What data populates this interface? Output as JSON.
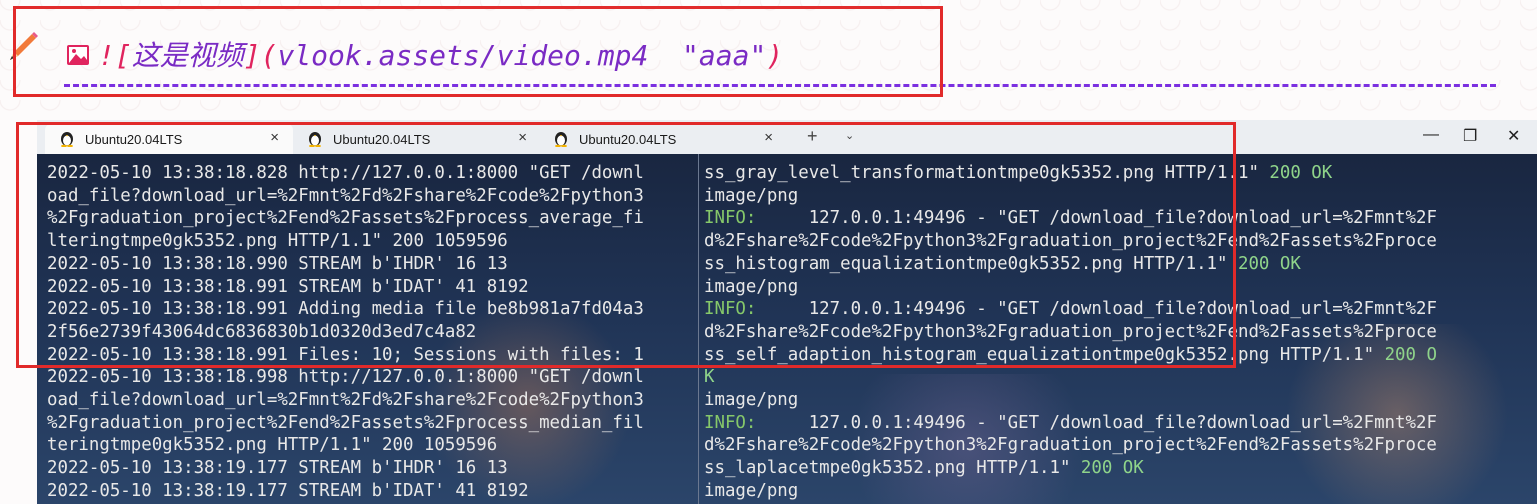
{
  "markdown": {
    "bang_bracket": "![",
    "alt_text": "这是视频",
    "close_bracket": "]",
    "open_paren": "(",
    "link": "vlook.assets/video.mp4  \"aaa\"",
    "close_paren": ")"
  },
  "terminal": {
    "tabs": [
      {
        "label": "Ubuntu20.04LTS",
        "close": "×"
      },
      {
        "label": "Ubuntu20.04LTS",
        "close": "×"
      },
      {
        "label": "Ubuntu20.04LTS",
        "close": "×"
      }
    ],
    "new_tab": "+",
    "dropdown": "⌄",
    "minimize": "—",
    "maximize": "❐",
    "close": "✕",
    "left_lines": [
      "2022-05-10 13:38:18.828 http://127.0.0.1:8000 \"GET /downl",
      "oad_file?download_url=%2Fmnt%2Fd%2Fshare%2Fcode%2Fpython3",
      "%2Fgraduation_project%2Fend%2Fassets%2Fprocess_average_fi",
      "lteringtmpe0gk5352.png HTTP/1.1\" 200 1059596",
      "2022-05-10 13:38:18.990 STREAM b'IHDR' 16 13",
      "2022-05-10 13:38:18.991 STREAM b'IDAT' 41 8192",
      "2022-05-10 13:38:18.991 Adding media file be8b981a7fd04a3",
      "2f56e2739f43064dc6836830b1d0320d3ed7c4a82",
      "2022-05-10 13:38:18.991 Files: 10; Sessions with files: 1",
      "2022-05-10 13:38:18.998 http://127.0.0.1:8000 \"GET /downl",
      "oad_file?download_url=%2Fmnt%2Fd%2Fshare%2Fcode%2Fpython3",
      "%2Fgraduation_project%2Fend%2Fassets%2Fprocess_median_fil",
      "teringtmpe0gk5352.png HTTP/1.1\" 200 1059596",
      "2022-05-10 13:38:19.177 STREAM b'IHDR' 16 13",
      "2022-05-10 13:38:19.177 STREAM b'IDAT' 41 8192"
    ],
    "right_lines": [
      {
        "text": "ss_gray_level_transformationtmpe0gk5352.png HTTP/1.1\" ",
        "ok": "200 OK"
      },
      {
        "text": "image/png"
      },
      {
        "info": "INFO:",
        "text": "     127.0.0.1:49496 - \"GET /download_file?download_url=%2Fmnt%2F"
      },
      {
        "text": "d%2Fshare%2Fcode%2Fpython3%2Fgraduation_project%2Fend%2Fassets%2Fproce"
      },
      {
        "text": "ss_histogram_equalizationtmpe0gk5352.png HTTP/1.1\" ",
        "ok": "200 OK"
      },
      {
        "text": "image/png"
      },
      {
        "info": "INFO:",
        "text": "     127.0.0.1:49496 - \"GET /download_file?download_url=%2Fmnt%2F"
      },
      {
        "text": "d%2Fshare%2Fcode%2Fpython3%2Fgraduation_project%2Fend%2Fassets%2Fproce"
      },
      {
        "text": "ss_self_adaption_histogram_equalizationtmpe0gk5352.png HTTP/1.1\" ",
        "ok": "200 O"
      },
      {
        "ok": "K"
      },
      {
        "text": "image/png"
      },
      {
        "info": "INFO:",
        "text": "     127.0.0.1:49496 - \"GET /download_file?download_url=%2Fmnt%2F"
      },
      {
        "text": "d%2Fshare%2Fcode%2Fpython3%2Fgraduation_project%2Fend%2Fassets%2Fproce"
      },
      {
        "text": "ss_laplacetmpe0gk5352.png HTTP/1.1\" ",
        "ok": "200 OK"
      },
      {
        "text": "image/png"
      }
    ]
  },
  "colors": {
    "accent_purple": "#7a2bc4",
    "highlight_red": "#e12a2a",
    "ok_green": "#8fd48a"
  }
}
